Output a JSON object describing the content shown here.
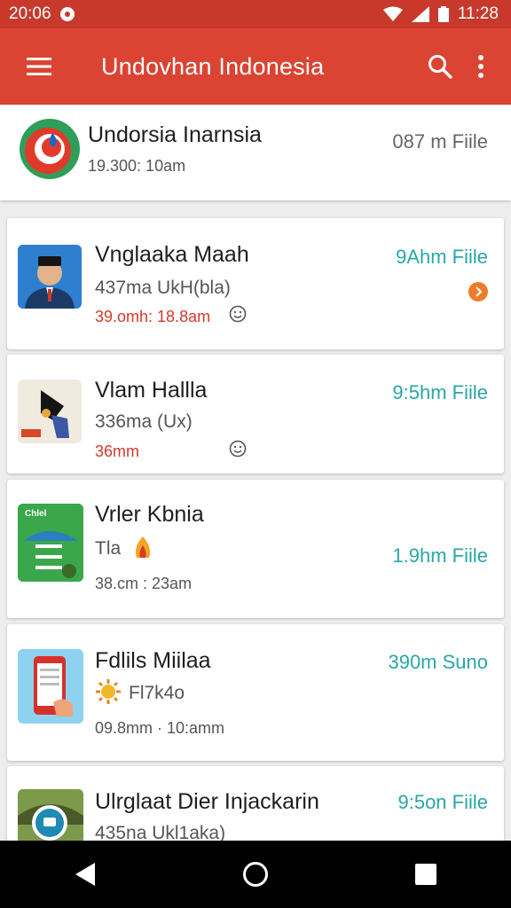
{
  "status_bar": {
    "time_left": "20:06",
    "time_right": "11:28"
  },
  "app_bar": {
    "title": "Undovhan Indonesia"
  },
  "items": [
    {
      "title": "Undorsia Inarnsia",
      "time": "19.300: 10am",
      "meta": "087 m Fiile"
    },
    {
      "title": "Vnglaaka Maah",
      "subtitle": "437ma UkH(bla)",
      "time": "39.omh: 18.8am",
      "meta": "9Ahm Fiile"
    },
    {
      "title": "Vlam Hallla",
      "subtitle": "336ma (Ux)",
      "time": "36mm",
      "meta": "9:5hm Fiile"
    },
    {
      "title": "Vrler Kbnia",
      "subtitle": "Tla",
      "time": "38.cm : 23am",
      "meta": "1.9hm Fiile",
      "thumb_text": "Chlel"
    },
    {
      "title": "Fdlils Miilaa",
      "subtitle": "Fl7k4o",
      "time": "09.8mm · 10:amm",
      "meta": "390m Suno"
    },
    {
      "title": "Ulrglaat Dier Injackarin",
      "subtitle": "435na Ukl1aka)",
      "meta": "9:5on Fiile"
    }
  ],
  "colors": {
    "app_bar": "#db4332",
    "accent_teal": "#2aa6a6",
    "time_red": "#d23a2a"
  }
}
